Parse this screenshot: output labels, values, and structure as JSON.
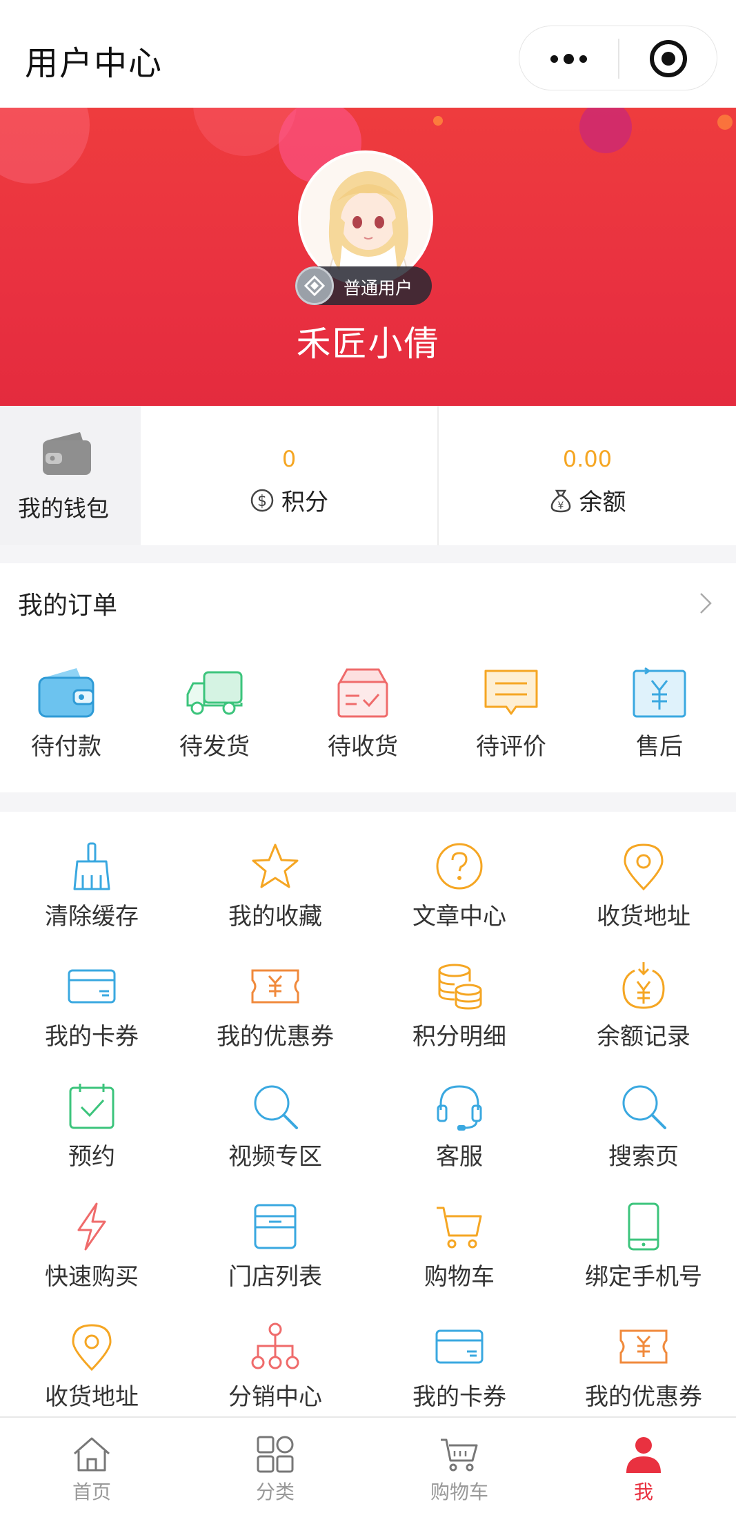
{
  "header": {
    "title": "用户中心",
    "more_icon": "more-dots-icon",
    "close_icon": "target-close-icon"
  },
  "profile": {
    "badge_label": "普通用户",
    "nickname": "禾匠小倩"
  },
  "wallet": {
    "title": "我的钱包",
    "points_value": "0",
    "points_label": "积分",
    "balance_value": "0.00",
    "balance_label": "余额"
  },
  "orders": {
    "title": "我的订单",
    "items": [
      {
        "label": "待付款",
        "icon": "wallet-icon"
      },
      {
        "label": "待发货",
        "icon": "truck-icon"
      },
      {
        "label": "待收货",
        "icon": "package-check-icon"
      },
      {
        "label": "待评价",
        "icon": "comment-icon"
      },
      {
        "label": "售后",
        "icon": "yuan-refund-icon"
      }
    ]
  },
  "menu": [
    {
      "label": "清除缓存",
      "icon": "broom-icon"
    },
    {
      "label": "我的收藏",
      "icon": "star-icon"
    },
    {
      "label": "文章中心",
      "icon": "question-icon"
    },
    {
      "label": "收货地址",
      "icon": "location-pin-icon"
    },
    {
      "label": "我的卡券",
      "icon": "card-icon"
    },
    {
      "label": "我的优惠券",
      "icon": "coupon-icon"
    },
    {
      "label": "积分明细",
      "icon": "coins-stack-icon"
    },
    {
      "label": "余额记录",
      "icon": "yuan-coin-icon"
    },
    {
      "label": "预约",
      "icon": "calendar-check-icon"
    },
    {
      "label": "视频专区",
      "icon": "search-icon"
    },
    {
      "label": "客服",
      "icon": "headset-icon"
    },
    {
      "label": "搜索页",
      "icon": "search-icon"
    },
    {
      "label": "快速购买",
      "icon": "lightning-icon"
    },
    {
      "label": "门店列表",
      "icon": "store-box-icon"
    },
    {
      "label": "购物车",
      "icon": "cart-icon"
    },
    {
      "label": "绑定手机号",
      "icon": "phone-icon"
    },
    {
      "label": "收货地址",
      "icon": "location-pin-icon"
    },
    {
      "label": "分销中心",
      "icon": "network-icon"
    },
    {
      "label": "我的卡券",
      "icon": "card-icon"
    },
    {
      "label": "我的优惠券",
      "icon": "coupon-icon"
    }
  ],
  "tabbar": [
    {
      "label": "首页",
      "icon": "home-icon"
    },
    {
      "label": "分类",
      "icon": "category-icon"
    },
    {
      "label": "购物车",
      "icon": "cart-icon"
    },
    {
      "label": "我",
      "icon": "user-icon"
    }
  ],
  "colors": {
    "accent": "#e93140",
    "amount": "#f5a623",
    "blue": "#3aa8e0",
    "orange": "#f5a623",
    "green": "#3cc47c",
    "pink": "#ef6b6b"
  }
}
